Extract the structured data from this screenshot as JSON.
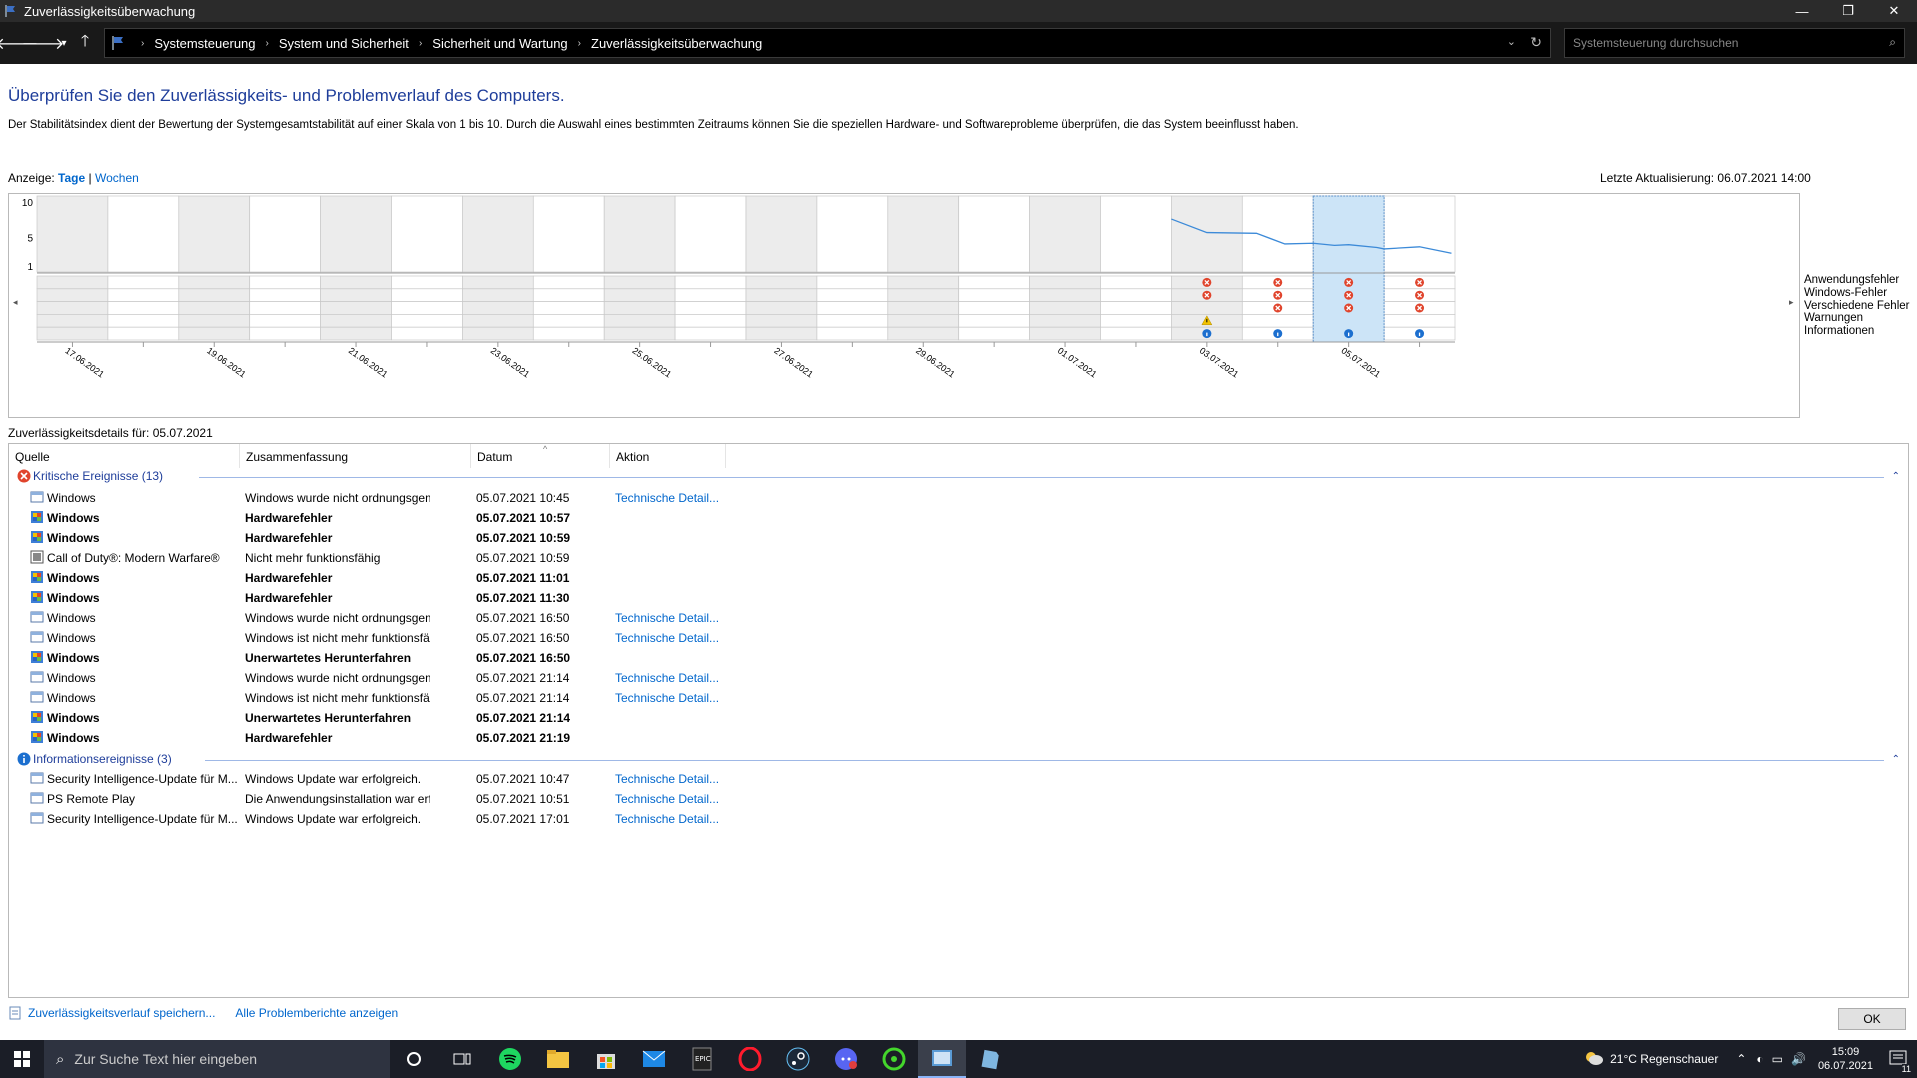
{
  "window": {
    "title": "Zuverlässigkeitsüberwachung",
    "minimize": "—",
    "maximize": "❐",
    "close": "✕"
  },
  "addressbar": {
    "crumbs": [
      "Systemsteuerung",
      "System und Sicherheit",
      "Sicherheit und Wartung",
      "Zuverlässigkeitsüberwachung"
    ],
    "search_placeholder": "Systemsteuerung durchsuchen"
  },
  "page": {
    "heading": "Überprüfen Sie den Zuverlässigkeits- und Problemverlauf des Computers.",
    "description": "Der Stabilitätsindex dient der Bewertung der Systemgesamtstabilität auf einer Skala von 1 bis 10. Durch die Auswahl eines bestimmten Zeitraums können Sie die speziellen Hardware- und Softwareprobleme überprüfen, die das System beeinflusst haben.",
    "view_label": "Anzeige:",
    "view_days": "Tage",
    "view_sep": "|",
    "view_weeks": "Wochen",
    "last_update": "Letzte Aktualisierung: 06.07.2021 14:00"
  },
  "chart_data": {
    "type": "line",
    "y_ticks": [
      "10",
      "5",
      "1"
    ],
    "ylim": [
      1,
      10
    ],
    "x_tick_labels": [
      "17.06.2021",
      "19.06.2021",
      "21.06.2021",
      "23.06.2021",
      "25.06.2021",
      "27.06.2021",
      "29.06.2021",
      "01.07.2021",
      "03.07.2021",
      "05.07.2021"
    ],
    "days": [
      "17.06.2021",
      "18.06.2021",
      "19.06.2021",
      "20.06.2021",
      "21.06.2021",
      "22.06.2021",
      "23.06.2021",
      "24.06.2021",
      "25.06.2021",
      "26.06.2021",
      "27.06.2021",
      "28.06.2021",
      "29.06.2021",
      "30.06.2021",
      "01.07.2021",
      "02.07.2021",
      "03.07.2021",
      "04.07.2021",
      "05.07.2021",
      "06.07.2021"
    ],
    "selected_day": "05.07.2021",
    "stability_series": [
      {
        "day": 16.0,
        "value": 7.6
      },
      {
        "day": 16.5,
        "value": 5.7
      },
      {
        "day": 17.2,
        "value": 5.6
      },
      {
        "day": 17.6,
        "value": 4.1
      },
      {
        "day": 18.0,
        "value": 4.2
      },
      {
        "day": 18.3,
        "value": 3.9
      },
      {
        "day": 18.5,
        "value": 4.0
      },
      {
        "day": 18.9,
        "value": 3.6
      },
      {
        "day": 19.0,
        "value": 3.4
      },
      {
        "day": 19.5,
        "value": 3.7
      },
      {
        "day": 19.95,
        "value": 2.8
      }
    ],
    "legend": [
      "Anwendungsfehler",
      "Windows-Fehler",
      "Verschiedene Fehler",
      "Warnungen",
      "Informationen"
    ],
    "event_markers": [
      {
        "day": 16,
        "row": 0,
        "kind": "error"
      },
      {
        "day": 16,
        "row": 1,
        "kind": "error"
      },
      {
        "day": 16,
        "row": 3,
        "kind": "warning"
      },
      {
        "day": 16,
        "row": 4,
        "kind": "info"
      },
      {
        "day": 17,
        "row": 0,
        "kind": "error"
      },
      {
        "day": 17,
        "row": 1,
        "kind": "error"
      },
      {
        "day": 17,
        "row": 2,
        "kind": "error"
      },
      {
        "day": 17,
        "row": 4,
        "kind": "info"
      },
      {
        "day": 18,
        "row": 0,
        "kind": "error"
      },
      {
        "day": 18,
        "row": 1,
        "kind": "error"
      },
      {
        "day": 18,
        "row": 2,
        "kind": "error"
      },
      {
        "day": 18,
        "row": 4,
        "kind": "info"
      },
      {
        "day": 19,
        "row": 0,
        "kind": "error"
      },
      {
        "day": 19,
        "row": 1,
        "kind": "error"
      },
      {
        "day": 19,
        "row": 2,
        "kind": "error"
      },
      {
        "day": 19,
        "row": 4,
        "kind": "info"
      }
    ]
  },
  "details": {
    "title": "Zuverlässigkeitsdetails für: 05.07.2021",
    "columns": [
      "Quelle",
      "Zusammenfassung",
      "Datum",
      "Aktion"
    ],
    "critical_group": "Kritische Ereignisse (13)",
    "critical_rows": [
      {
        "icon": "window",
        "source": "Windows",
        "summary": "Windows wurde nicht ordnungsgemäß ...",
        "date": "05.07.2021 10:45",
        "action": "Technische Detail...",
        "bold": false
      },
      {
        "icon": "shield",
        "source": "Windows",
        "summary": "Hardwarefehler",
        "date": "05.07.2021 10:57",
        "action": "",
        "bold": true
      },
      {
        "icon": "shield",
        "source": "Windows",
        "summary": "Hardwarefehler",
        "date": "05.07.2021 10:59",
        "action": "",
        "bold": true
      },
      {
        "icon": "app",
        "source": "Call of Duty®: Modern Warfare®",
        "summary": "Nicht mehr funktionsfähig",
        "date": "05.07.2021 10:59",
        "action": "",
        "bold": false
      },
      {
        "icon": "shield",
        "source": "Windows",
        "summary": "Hardwarefehler",
        "date": "05.07.2021 11:01",
        "action": "",
        "bold": true
      },
      {
        "icon": "shield",
        "source": "Windows",
        "summary": "Hardwarefehler",
        "date": "05.07.2021 11:30",
        "action": "",
        "bold": true
      },
      {
        "icon": "window",
        "source": "Windows",
        "summary": "Windows wurde nicht ordnungsgemäß ...",
        "date": "05.07.2021 16:50",
        "action": "Technische Detail...",
        "bold": false
      },
      {
        "icon": "window",
        "source": "Windows",
        "summary": "Windows ist nicht mehr funktionsfähig.",
        "date": "05.07.2021 16:50",
        "action": "Technische Detail...",
        "bold": false
      },
      {
        "icon": "shield",
        "source": "Windows",
        "summary": "Unerwartetes Herunterfahren",
        "date": "05.07.2021 16:50",
        "action": "",
        "bold": true
      },
      {
        "icon": "window",
        "source": "Windows",
        "summary": "Windows wurde nicht ordnungsgemäß ...",
        "date": "05.07.2021 21:14",
        "action": "Technische Detail...",
        "bold": false
      },
      {
        "icon": "window",
        "source": "Windows",
        "summary": "Windows ist nicht mehr funktionsfähig.",
        "date": "05.07.2021 21:14",
        "action": "Technische Detail...",
        "bold": false
      },
      {
        "icon": "shield",
        "source": "Windows",
        "summary": "Unerwartetes Herunterfahren",
        "date": "05.07.2021 21:14",
        "action": "",
        "bold": true
      },
      {
        "icon": "shield",
        "source": "Windows",
        "summary": "Hardwarefehler",
        "date": "05.07.2021 21:19",
        "action": "",
        "bold": true
      }
    ],
    "info_group": "Informationsereignisse (3)",
    "info_rows": [
      {
        "icon": "window",
        "source": "Security Intelligence-Update für M...",
        "summary": "Windows Update war erfolgreich.",
        "date": "05.07.2021 10:47",
        "action": "Technische Detail...",
        "bold": false
      },
      {
        "icon": "window",
        "source": "PS Remote Play",
        "summary": "Die Anwendungsinstallation war erfolgr...",
        "date": "05.07.2021 10:51",
        "action": "Technische Detail...",
        "bold": false
      },
      {
        "icon": "window",
        "source": "Security Intelligence-Update für M...",
        "summary": "Windows Update war erfolgreich.",
        "date": "05.07.2021 17:01",
        "action": "Technische Detail...",
        "bold": false
      }
    ]
  },
  "footer": {
    "save_link": "Zuverlässigkeitsverlauf speichern...",
    "reports_link": "Alle Problemberichte anzeigen",
    "ok": "OK"
  },
  "taskbar": {
    "search_placeholder": "Zur Suche Text hier eingeben",
    "weather": "21°C  Regenschauer",
    "time": "15:09",
    "date": "06.07.2021",
    "notification_count": "11"
  }
}
